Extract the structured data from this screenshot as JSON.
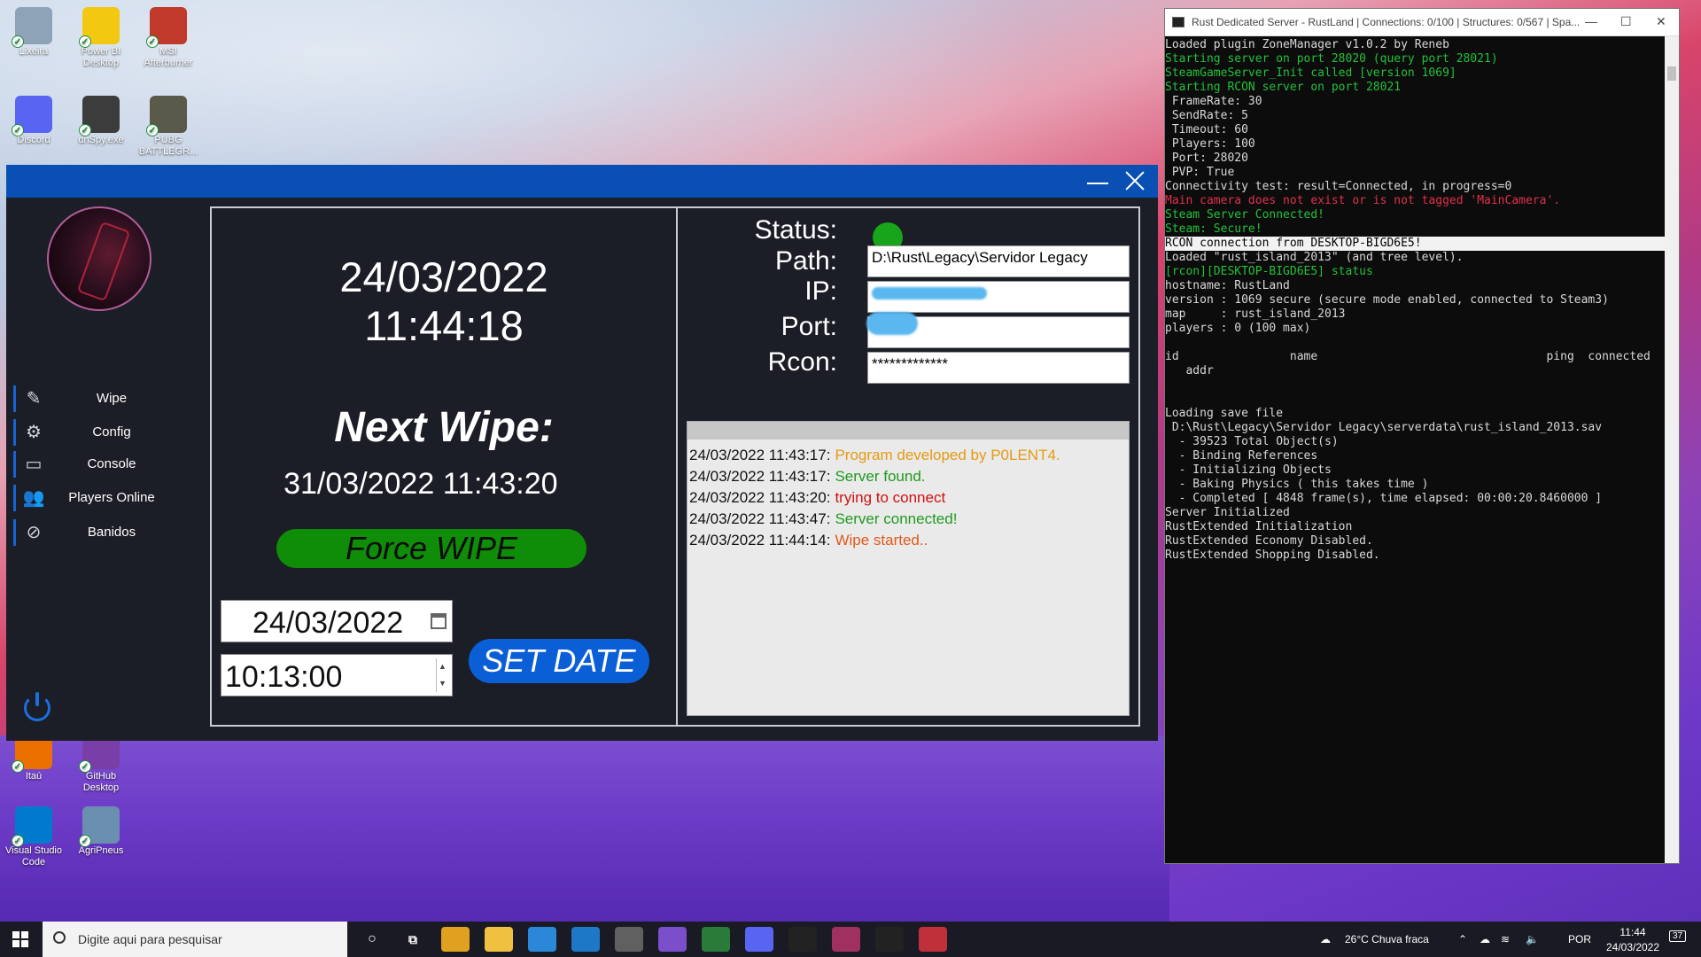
{
  "desktop": {
    "icons": [
      {
        "label": "Lixeira",
        "color": "#8fa3b8"
      },
      {
        "label": "Power BI Desktop",
        "color": "#f2c811"
      },
      {
        "label": "MSI Afterburner",
        "color": "#c0392b"
      },
      {
        "label": "Discord",
        "color": "#5865f2"
      },
      {
        "label": "dnSpy.exe",
        "color": "#3c3c3c"
      },
      {
        "label": "PUBG BATTLEGR...",
        "color": "#5a5a4a"
      },
      {
        "label": "Itaú",
        "color": "#ec7000"
      },
      {
        "label": "GitHub Desktop",
        "color": "#7a3ea8"
      },
      {
        "label": "Visual Studio Code",
        "color": "#007acc"
      },
      {
        "label": "AgriPneus",
        "color": "#6a8fb0"
      }
    ]
  },
  "app": {
    "sidebar": [
      {
        "label": "Wipe",
        "icon": "broom-icon"
      },
      {
        "label": "Config",
        "icon": "gear-icon"
      },
      {
        "label": "Console",
        "icon": "terminal-icon"
      },
      {
        "label": "Players Online",
        "icon": "players-icon"
      },
      {
        "label": "Banidos",
        "icon": "user-ban-icon"
      }
    ],
    "clock_date": "24/03/2022",
    "clock_time": "11:44:18",
    "next_wipe_title": "Next Wipe:",
    "next_wipe_date": "31/03/2022 11:43:20",
    "force_wipe_label": "Force WIPE",
    "date_input": "24/03/2022",
    "time_input": "10:13:00",
    "set_date_label": "SET DATE",
    "fields": {
      "status_label": "Status:",
      "path_label": "Path:",
      "path_value": "D:\\Rust\\Legacy\\Servidor Legacy",
      "ip_label": "IP:",
      "port_label": "Port:",
      "rcon_label": "Rcon:",
      "rcon_value": "*************"
    },
    "status_color": "#18a51b",
    "log": [
      {
        "time": "24/03/2022 11:43:17:",
        "msg": "Program developed by P0LENT4.",
        "color": "#e69a10"
      },
      {
        "time": "24/03/2022 11:43:17:",
        "msg": "Server found.",
        "color": "#1f9a1f"
      },
      {
        "time": "24/03/2022 11:43:20:",
        "msg": "trying to connect",
        "color": "#d01010"
      },
      {
        "time": "24/03/2022 11:43:47:",
        "msg": "Server connected!",
        "color": "#1f9a1f"
      },
      {
        "time": "24/03/2022 11:44:14:",
        "msg": "Wipe started..",
        "color": "#e05a1a"
      }
    ]
  },
  "console": {
    "title": "Rust Dedicated Server - RustLand | Connections: 0/100 | Structures: 0/567 | Spa...",
    "lines": [
      {
        "t": "Loaded plugin ZoneManager v1.0.2 by Reneb",
        "c": "#d8d8d8"
      },
      {
        "t": "Starting server on port 28020 (query port 28021)",
        "c": "#22c13a"
      },
      {
        "t": "SteamGameServer_Init called [version 1069]",
        "c": "#22c13a"
      },
      {
        "t": "Starting RCON server on port 28021",
        "c": "#22c13a"
      },
      {
        "t": " FrameRate: 30",
        "c": "#d8d8d8"
      },
      {
        "t": " SendRate: 5",
        "c": "#d8d8d8"
      },
      {
        "t": " Timeout: 60",
        "c": "#d8d8d8"
      },
      {
        "t": " Players: 100",
        "c": "#d8d8d8"
      },
      {
        "t": " Port: 28020",
        "c": "#d8d8d8"
      },
      {
        "t": " PVP: True",
        "c": "#d8d8d8"
      },
      {
        "t": "Connectivity test: result=Connected, in progress=0",
        "c": "#d8d8d8"
      },
      {
        "t": "Main camera does not exist or is not tagged 'MainCamera'.",
        "c": "#e0304a"
      },
      {
        "t": "Steam Server Connected!",
        "c": "#22c13a"
      },
      {
        "t": "Steam: Secure!",
        "c": "#22c13a"
      },
      {
        "t": "RCON connection from DESKTOP-BIGD6E5!",
        "c": "#000000",
        "bg": "#f2f2f2"
      },
      {
        "t": "Loaded \"rust_island_2013\" (and tree level).",
        "c": "#d8d8d8"
      },
      {
        "t": "[rcon][DESKTOP-BIGD6E5] status",
        "c": "#22c13a"
      },
      {
        "t": "hostname: RustLand",
        "c": "#d8d8d8"
      },
      {
        "t": "version : 1069 secure (secure mode enabled, connected to Steam3)",
        "c": "#d8d8d8"
      },
      {
        "t": "map     : rust_island_2013",
        "c": "#d8d8d8"
      },
      {
        "t": "players : 0 (100 max)",
        "c": "#d8d8d8"
      },
      {
        "t": "",
        "c": "#d8d8d8"
      },
      {
        "t": "id                name                                 ping  connected",
        "c": "#d8d8d8"
      },
      {
        "t": "   addr",
        "c": "#d8d8d8"
      },
      {
        "t": "",
        "c": "#d8d8d8"
      },
      {
        "t": "",
        "c": "#d8d8d8"
      },
      {
        "t": "Loading save file",
        "c": "#d8d8d8"
      },
      {
        "t": " D:\\Rust\\Legacy\\Servidor Legacy\\serverdata\\rust_island_2013.sav",
        "c": "#d8d8d8"
      },
      {
        "t": "  - 39523 Total Object(s)",
        "c": "#d8d8d8"
      },
      {
        "t": "  - Binding References",
        "c": "#d8d8d8"
      },
      {
        "t": "  - Initializing Objects",
        "c": "#d8d8d8"
      },
      {
        "t": "  - Baking Physics ( this takes time )",
        "c": "#d8d8d8"
      },
      {
        "t": "  - Completed [ 4848 frame(s), time elapsed: 00:00:20.8460000 ]",
        "c": "#d8d8d8"
      },
      {
        "t": "Server Initialized",
        "c": "#d8d8d8"
      },
      {
        "t": "RustExtended Initialization",
        "c": "#d8d8d8"
      },
      {
        "t": "RustExtended Economy Disabled.",
        "c": "#d8d8d8"
      },
      {
        "t": "RustExtended Shopping Disabled.",
        "c": "#d8d8d8"
      }
    ]
  },
  "taskbar": {
    "search_placeholder": "Digite aqui para pesquisar",
    "apps": [
      {
        "name": "chrome",
        "color": "#e0a020"
      },
      {
        "name": "explorer",
        "color": "#f0c040"
      },
      {
        "name": "store",
        "color": "#2b88d8"
      },
      {
        "name": "mail",
        "color": "#1e78c8"
      },
      {
        "name": "calculator",
        "color": "#606060"
      },
      {
        "name": "visual-studio",
        "color": "#7b4fc9"
      },
      {
        "name": "perf-monitor",
        "color": "#2a7a3a"
      },
      {
        "name": "discord",
        "color": "#5865f2"
      },
      {
        "name": "logitech",
        "color": "#222222"
      },
      {
        "name": "winrar",
        "color": "#a03060"
      },
      {
        "name": "terminal",
        "color": "#222222"
      },
      {
        "name": "rust-app",
        "color": "#c0303a"
      }
    ],
    "weather": "26°C  Chuva fraca",
    "lang": "POR",
    "time": "11:44",
    "date": "24/03/2022",
    "notifications": "37"
  }
}
